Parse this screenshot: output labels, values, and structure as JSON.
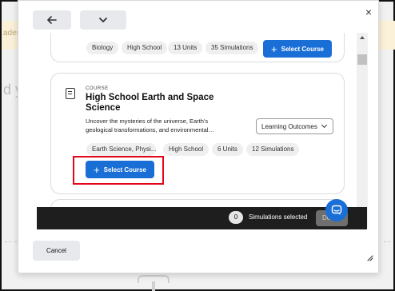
{
  "background": {
    "banner_fragment": "ades",
    "heading_fragment": "d y"
  },
  "modal": {
    "close_label": "×",
    "cancel_label": "Cancel"
  },
  "previous_card": {
    "chips": [
      "Biology",
      "High School",
      "13 Units",
      "35 Simulations"
    ],
    "select_label": "Select Course"
  },
  "course_card": {
    "eyebrow": "COURSE",
    "title": "High School Earth and Space Science",
    "description": "Uncover the mysteries of the universe, Earth's geological transformations, and environmental…",
    "dropdown_label": "Learning Outcomes",
    "chips": [
      "Earth Science, Physi...",
      "High School",
      "6 Units",
      "12 Simulations"
    ],
    "select_label": "Select Course"
  },
  "selection_bar": {
    "count": "0",
    "label": "Simulations selected",
    "done_label": "Done"
  },
  "colors": {
    "accent": "#1a6fd6",
    "highlight": "#e3061b",
    "bar": "#1e1e1e"
  }
}
